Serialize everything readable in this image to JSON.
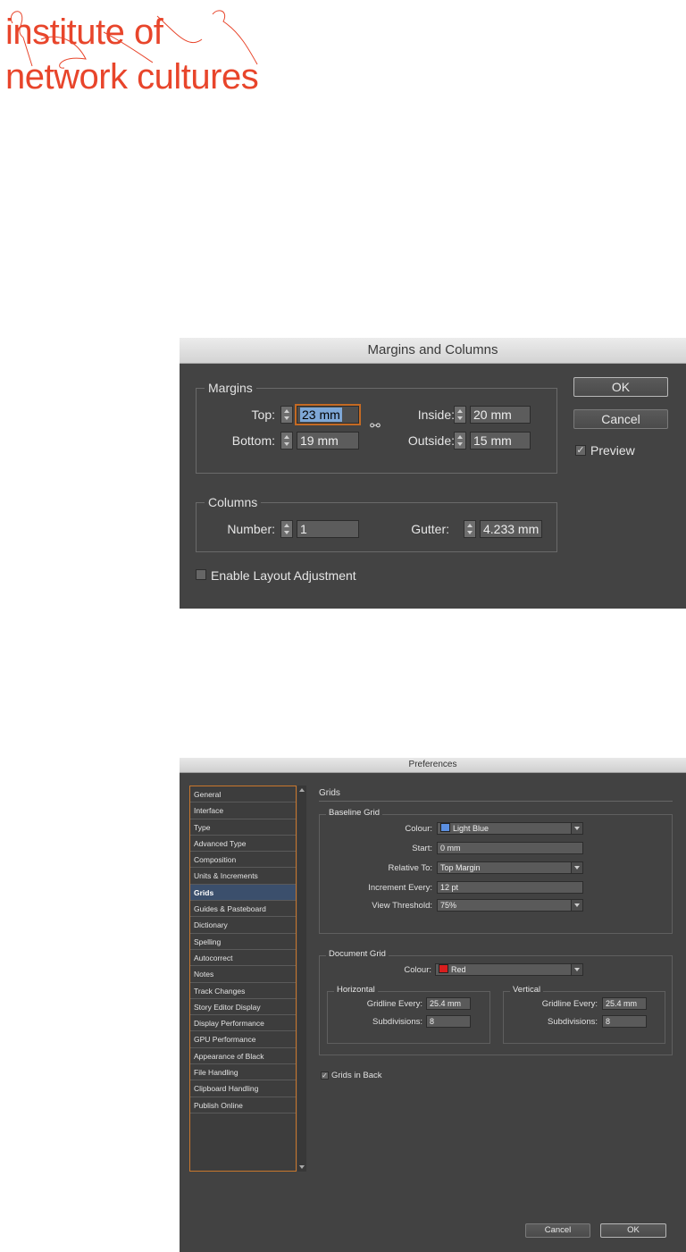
{
  "logo": {
    "line1": "institute of",
    "line2": "network cultures",
    "color": "#e8452b"
  },
  "margins_dialog": {
    "title": "Margins and Columns",
    "margins_group": "Margins",
    "top_label": "Top:",
    "top_value": "23 mm",
    "bottom_label": "Bottom:",
    "bottom_value": "19 mm",
    "inside_label": "Inside:",
    "inside_value": "20 mm",
    "outside_label": "Outside:",
    "outside_value": "15 mm",
    "columns_group": "Columns",
    "number_label": "Number:",
    "number_value": "1",
    "gutter_label": "Gutter:",
    "gutter_value": "4.233 mm",
    "enable_layout_label": "Enable Layout Adjustment",
    "enable_layout_checked": false,
    "ok_label": "OK",
    "cancel_label": "Cancel",
    "preview_label": "Preview",
    "preview_checked": true,
    "chain_icon": "chain-link-icon"
  },
  "prefs_dialog": {
    "title": "Preferences",
    "sidebar": [
      "General",
      "Interface",
      "Type",
      "Advanced Type",
      "Composition",
      "Units & Increments",
      "Grids",
      "Guides & Pasteboard",
      "Dictionary",
      "Spelling",
      "Autocorrect",
      "Notes",
      "Track Changes",
      "Story Editor Display",
      "Display Performance",
      "GPU Performance",
      "Appearance of Black",
      "File Handling",
      "Clipboard Handling",
      "Publish Online"
    ],
    "selected": "Grids",
    "section_title": "Grids",
    "baseline": {
      "group": "Baseline Grid",
      "colour_label": "Colour:",
      "colour_value": "Light Blue",
      "colour_swatch": "#5b8fe0",
      "start_label": "Start:",
      "start_value": "0 mm",
      "relative_label": "Relative To:",
      "relative_value": "Top Margin",
      "increment_label": "Increment Every:",
      "increment_value": "12 pt",
      "threshold_label": "View Threshold:",
      "threshold_value": "75%"
    },
    "document": {
      "group": "Document Grid",
      "colour_label": "Colour:",
      "colour_value": "Red",
      "colour_swatch": "#d81e1e",
      "horizontal": {
        "group": "Horizontal",
        "gridline_label": "Gridline Every:",
        "gridline_value": "25.4 mm",
        "subdiv_label": "Subdivisions:",
        "subdiv_value": "8"
      },
      "vertical": {
        "group": "Vertical",
        "gridline_label": "Gridline Every:",
        "gridline_value": "25.4 mm",
        "subdiv_label": "Subdivisions:",
        "subdiv_value": "8"
      }
    },
    "grids_in_back_label": "Grids in Back",
    "grids_in_back_checked": true,
    "cancel_label": "Cancel",
    "ok_label": "OK"
  }
}
